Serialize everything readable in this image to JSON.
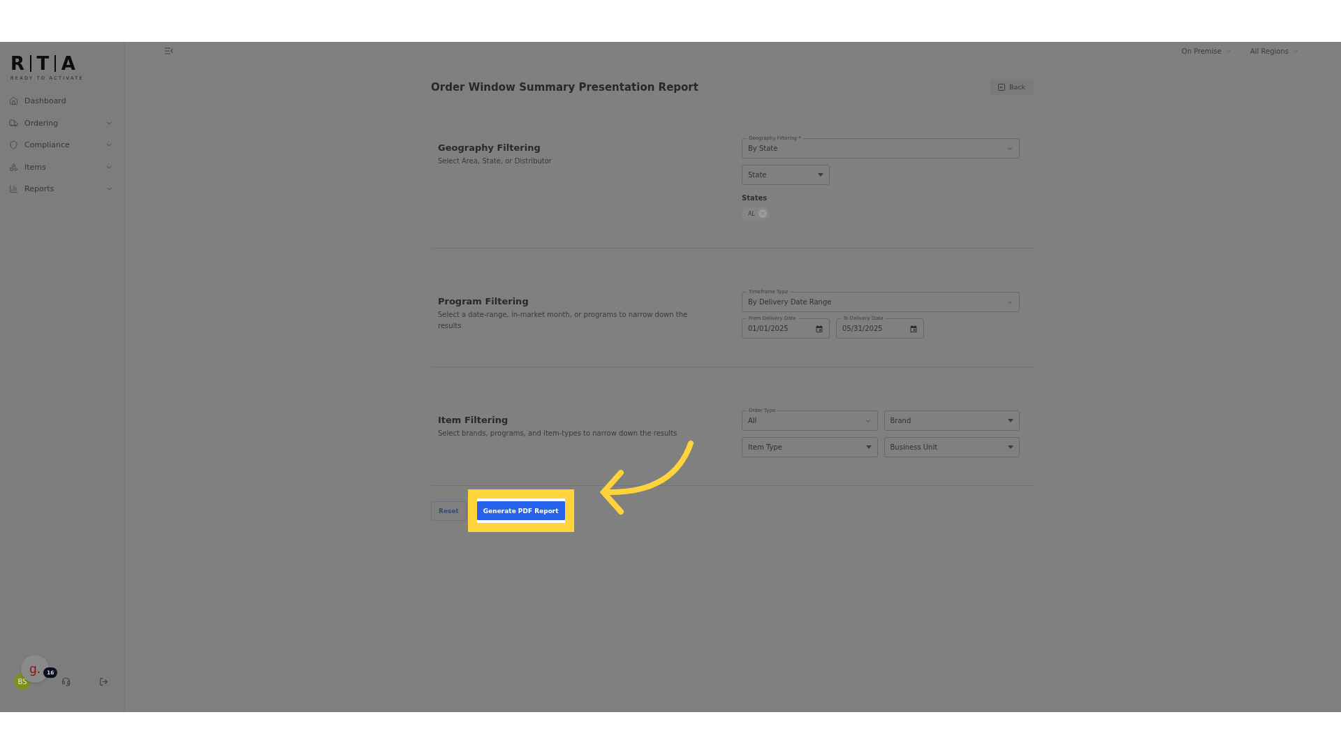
{
  "logo": {
    "letters": [
      "R",
      "T",
      "A"
    ],
    "tagline": "READY TO ACTIVATE"
  },
  "sidebar": {
    "items": [
      {
        "label": "Dashboard",
        "has_submenu": false
      },
      {
        "label": "Ordering",
        "has_submenu": true
      },
      {
        "label": "Compliance",
        "has_submenu": true
      },
      {
        "label": "Items",
        "has_submenu": true
      },
      {
        "label": "Reports",
        "has_submenu": true
      }
    ]
  },
  "top_bar": {
    "selectors": [
      "On Premise",
      "All Regions"
    ]
  },
  "page": {
    "title": "Order Window Summary Presentation Report",
    "back_button": "Back"
  },
  "sections": [
    {
      "title": "Geography Filtering",
      "description": "Select Area, State, or Distributor",
      "rows": [
        [
          {
            "kind": "select",
            "label": "Geography Filtering *",
            "value": "By State"
          }
        ],
        [
          {
            "kind": "dropdown",
            "placeholder": "State"
          }
        ],
        [
          {
            "kind": "chips",
            "label": "States",
            "chips": [
              "AL"
            ]
          }
        ]
      ]
    },
    {
      "title": "Program Filtering",
      "description": "Select a date-range, in-market month, or programs to narrow down the results",
      "rows": [
        [
          {
            "kind": "select",
            "label": "Timeframe Type",
            "value": "By Delivery Date Range"
          }
        ],
        [
          {
            "kind": "date",
            "label": "From Delivery Date",
            "value": "01/01/2025"
          },
          {
            "kind": "date",
            "label": "To Delivery Date",
            "value": "05/31/2025"
          }
        ]
      ]
    },
    {
      "title": "Item Filtering",
      "description": "Select brands, programs, and item-types to narrow down the results",
      "rows": [
        [
          {
            "kind": "select",
            "label": "Order Type",
            "value": "All"
          },
          {
            "kind": "dropdown",
            "placeholder": "Brand"
          }
        ],
        [
          {
            "kind": "dropdown",
            "placeholder": "Item Type"
          },
          {
            "kind": "dropdown",
            "placeholder": "Business Unit"
          }
        ]
      ]
    }
  ],
  "actions": [
    {
      "label": "Reset",
      "kind": "outline",
      "highlighted": false
    },
    {
      "label": "Generate PDF Report",
      "kind": "primary",
      "highlighted": true
    }
  ],
  "footer": {
    "assistant_logo": "g.",
    "user_initials": "BS",
    "notification_count": "16"
  }
}
